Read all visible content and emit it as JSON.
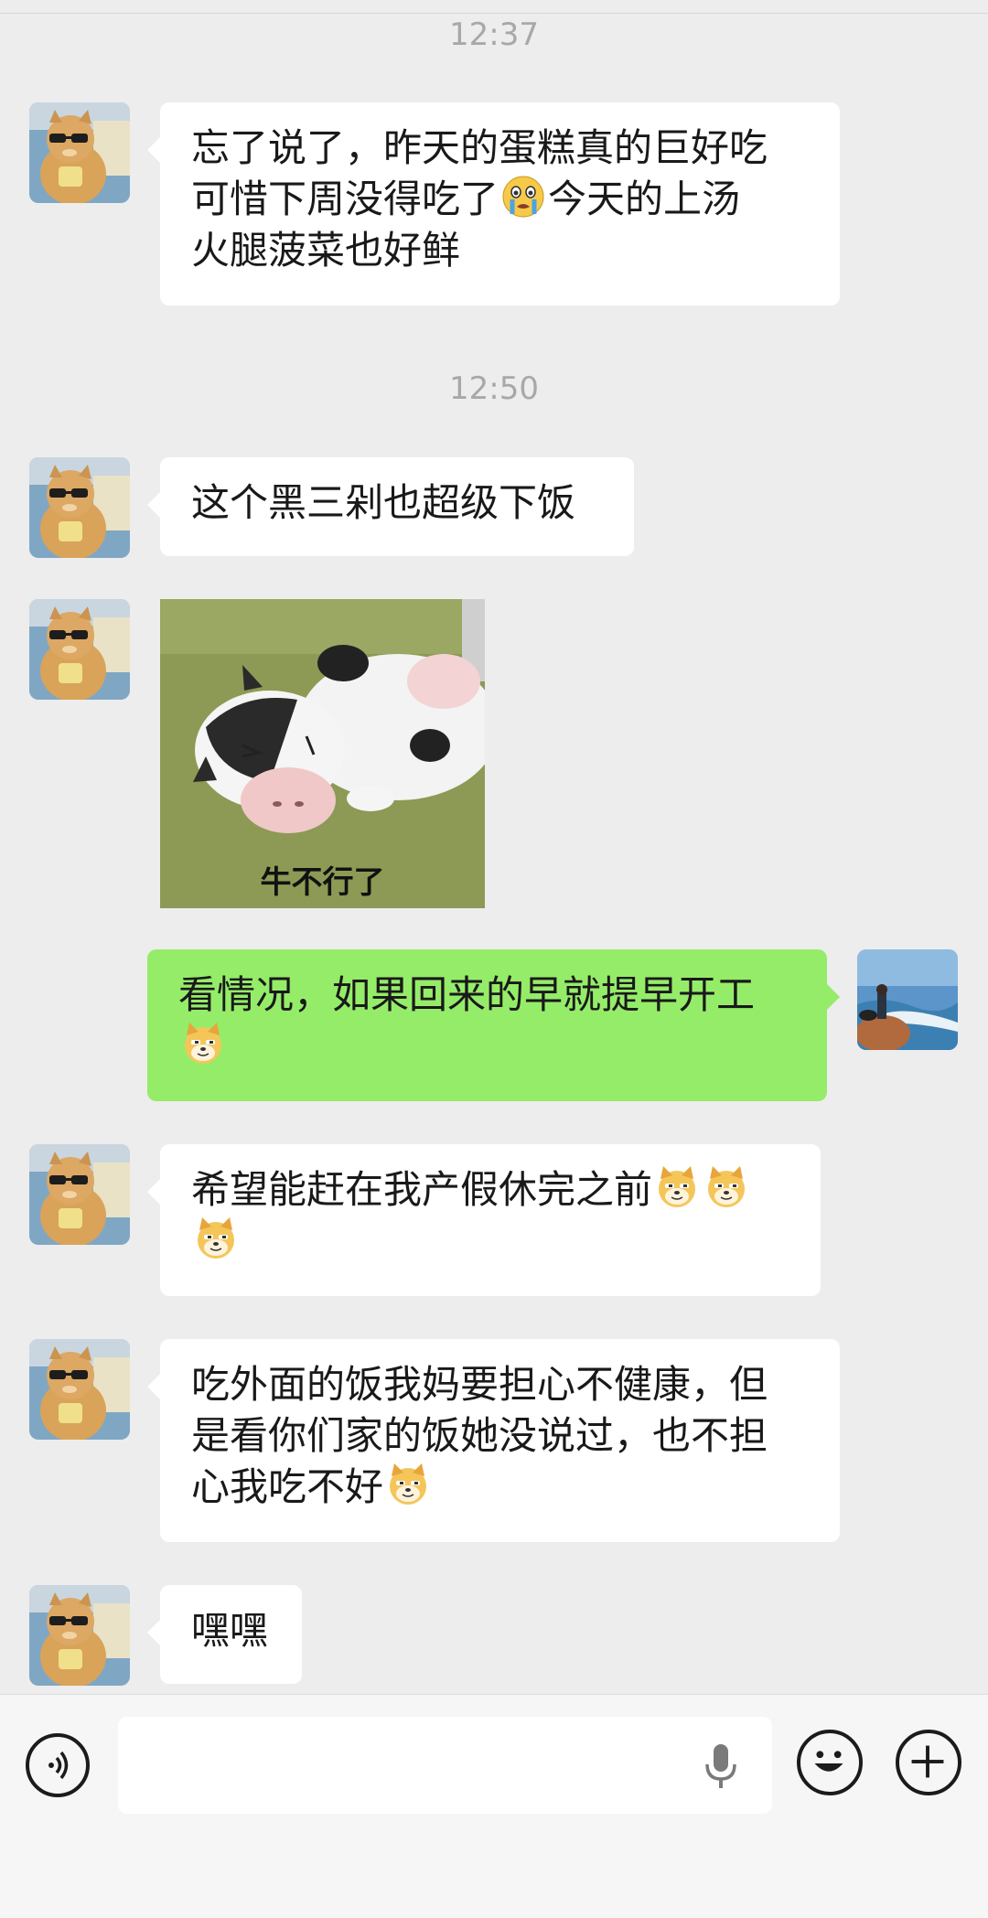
{
  "chat": {
    "timestamps": [
      "12:37",
      "12:50"
    ],
    "messages": [
      {
        "text_a": "忘了说了，昨天的蛋糕真的巨好吃",
        "text_b": "可惜下周没得吃了",
        "text_c": "今天的上汤",
        "text_d": "火腿菠菜也好鲜"
      },
      {
        "text": "这个黑三剁也超级下饭"
      },
      {
        "sticker_caption": "牛不行了"
      },
      {
        "text_a": "看情况，如果回来的早就提早开工"
      },
      {
        "text_a": "希望能赶在我产假休完之前"
      },
      {
        "text_a": "吃外面的饭我妈要担心不健康，但",
        "text_b": "是看你们家的饭她没说过，也不担",
        "text_c": "心我吃不好"
      },
      {
        "text": "嘿嘿"
      }
    ]
  },
  "icons": {
    "crying_emoji": "crying-emoji-icon",
    "doge_emoji": "doge-emoji-icon",
    "voice": "voice-icon",
    "mic": "mic-icon",
    "smiley": "smiley-icon",
    "plus": "plus-icon"
  },
  "colors": {
    "background": "#ededed",
    "received_bubble": "#ffffff",
    "sent_bubble": "#95ec69",
    "timestamp": "#a8a8a8"
  }
}
